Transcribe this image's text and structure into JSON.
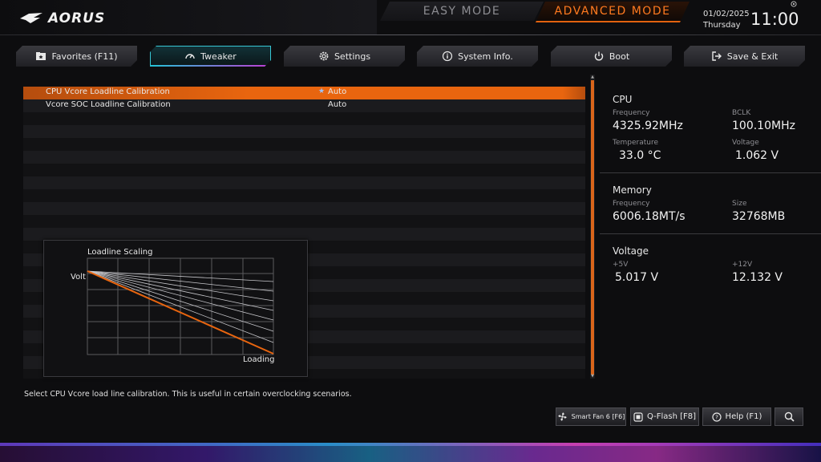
{
  "header": {
    "logo_text": "AORUS",
    "easy_mode": "EASY MODE",
    "advanced_mode": "ADVANCED MODE",
    "date": "01/02/2025",
    "day": "Thursday",
    "time": "11:00"
  },
  "tabs": [
    {
      "label": "Favorites (F11)",
      "icon": "favorites-icon"
    },
    {
      "label": "Tweaker",
      "icon": "speedometer-icon",
      "active": true
    },
    {
      "label": "Settings",
      "icon": "gear-icon"
    },
    {
      "label": "System Info.",
      "icon": "info-icon"
    },
    {
      "label": "Boot",
      "icon": "power-icon"
    },
    {
      "label": "Save & Exit",
      "icon": "exit-icon"
    }
  ],
  "settings": [
    {
      "label": "CPU Vcore Loadline Calibration",
      "value": "Auto",
      "selected": true
    },
    {
      "label": "Vcore SOC Loadline Calibration",
      "value": "Auto",
      "selected": false
    }
  ],
  "graph": {
    "title": "Loadline Scaling",
    "ylabel": "Volt",
    "xlabel": "Loading"
  },
  "info": {
    "cpu": {
      "title": "CPU",
      "frequency_label": "Frequency",
      "frequency": "4325.92MHz",
      "bclk_label": "BCLK",
      "bclk": "100.10MHz",
      "temperature_label": "Temperature",
      "temperature": "33.0 °C",
      "voltage_label": "Voltage",
      "voltage": "1.062 V"
    },
    "memory": {
      "title": "Memory",
      "frequency_label": "Frequency",
      "frequency": "6006.18MT/s",
      "size_label": "Size",
      "size": "32768MB"
    },
    "voltage": {
      "title": "Voltage",
      "v5_label": "+5V",
      "v5": "5.017 V",
      "v12_label": "+12V",
      "v12": "12.132 V"
    }
  },
  "help_text": "Select CPU Vcore load line calibration. This is useful in certain overclocking scenarios.",
  "bottom_buttons": {
    "smart_fan": "Smart Fan 6 [F6]",
    "qflash": "Q-Flash [F8]",
    "help": "Help (F1)"
  },
  "colors": {
    "accent": "#e8650f",
    "active_tab": "#37c6d4"
  }
}
